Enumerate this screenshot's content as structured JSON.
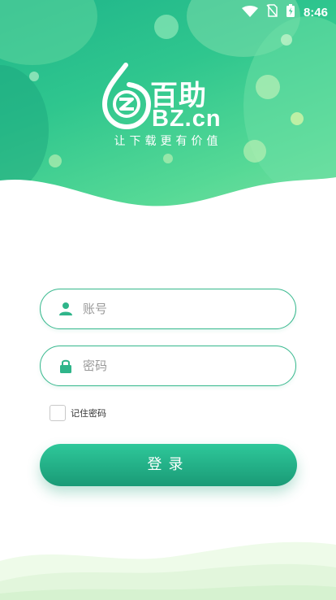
{
  "status_bar": {
    "time": "8:46",
    "icons": [
      "wifi-icon",
      "no-sim-icon",
      "battery-icon"
    ]
  },
  "brand": {
    "name_cn": "百助",
    "name_en": "BZ.cn",
    "tagline": "让下载更有价值"
  },
  "form": {
    "account_placeholder": "账号",
    "password_placeholder": "密码",
    "remember_label": "记住密码",
    "remember_checked": false,
    "login_label": "登录"
  },
  "colors": {
    "primary": "#2ec89a",
    "primary_dark": "#1a9a76",
    "border": "#36b88d",
    "hero_light": "#86e3a4"
  }
}
